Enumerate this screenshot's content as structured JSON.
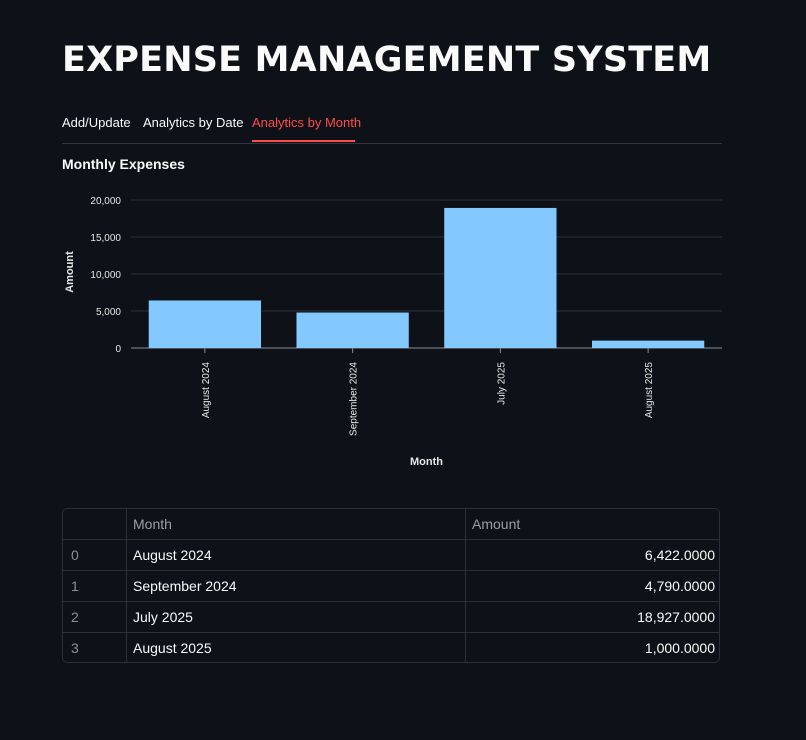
{
  "app": {
    "title": "EXPENSE MANAGEMENT SYSTEM"
  },
  "tabs": [
    {
      "label": "Add/Update",
      "active": false
    },
    {
      "label": "Analytics by Date",
      "active": false
    },
    {
      "label": "Analytics by Month",
      "active": true
    }
  ],
  "section": {
    "subheader": "Monthly Expenses"
  },
  "colors": {
    "background": "#0e1117",
    "accent": "#ff4b4b",
    "bar": "#83c9ff",
    "text": "#fafafa",
    "muted": "#9a9ea8",
    "grid": "#2f323a"
  },
  "chart_data": {
    "type": "bar",
    "categories": [
      "August 2024",
      "September 2024",
      "July 2025",
      "August 2025"
    ],
    "values": [
      6422,
      4790,
      18927,
      1000
    ],
    "xlabel": "Month",
    "ylabel": "Amount",
    "ylim": [
      0,
      20000
    ],
    "yticks": [
      0,
      5000,
      10000,
      15000,
      20000
    ],
    "ytick_labels": [
      "0",
      "5,000",
      "10,000",
      "15,000",
      "20,000"
    ],
    "grid": true,
    "legend": "none"
  },
  "table": {
    "columns": [
      "",
      "Month",
      "Amount"
    ],
    "rows": [
      {
        "index": "0",
        "month": "August 2024",
        "amount": "6,422.0000"
      },
      {
        "index": "1",
        "month": "September 2024",
        "amount": "4,790.0000"
      },
      {
        "index": "2",
        "month": "July 2025",
        "amount": "18,927.0000"
      },
      {
        "index": "3",
        "month": "August 2025",
        "amount": "1,000.0000"
      }
    ]
  }
}
